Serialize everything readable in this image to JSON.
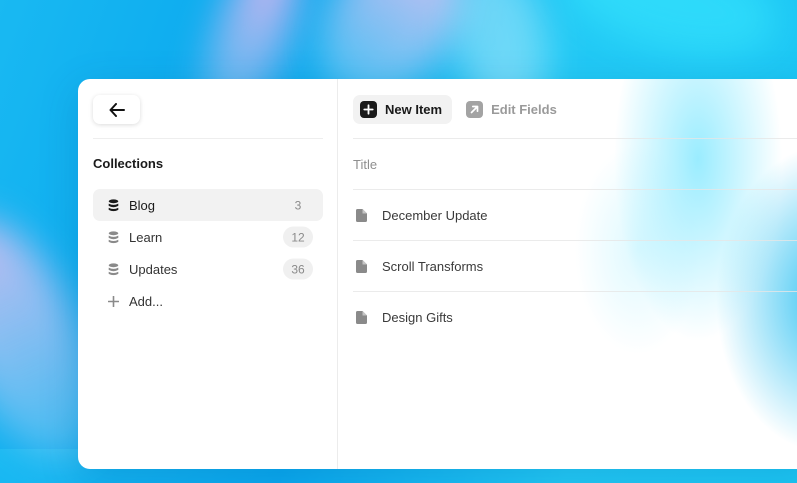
{
  "colors": {
    "accent_dark": "#1a1a1a",
    "muted_text": "#8f8f8f",
    "selected_bg": "#f2f2f2"
  },
  "sidebar": {
    "back_icon": "arrow-left-icon",
    "heading": "Collections",
    "collections": [
      {
        "label": "Blog",
        "count": "3",
        "icon": "database-icon",
        "active": true
      },
      {
        "label": "Learn",
        "count": "12",
        "icon": "database-icon",
        "active": false
      },
      {
        "label": "Updates",
        "count": "36",
        "icon": "database-icon",
        "active": false
      }
    ],
    "add_label": "Add...",
    "add_icon": "plus-icon"
  },
  "toolbar": {
    "new_item_label": "New Item",
    "new_item_icon": "plus-square-icon",
    "edit_fields_label": "Edit Fields",
    "edit_fields_icon": "arrow-up-right-square-icon"
  },
  "table": {
    "column_header": "Title",
    "rows": [
      {
        "title": "December Update",
        "icon": "document-icon"
      },
      {
        "title": "Scroll Transforms",
        "icon": "document-icon"
      },
      {
        "title": "Design Gifts",
        "icon": "document-icon"
      }
    ]
  }
}
